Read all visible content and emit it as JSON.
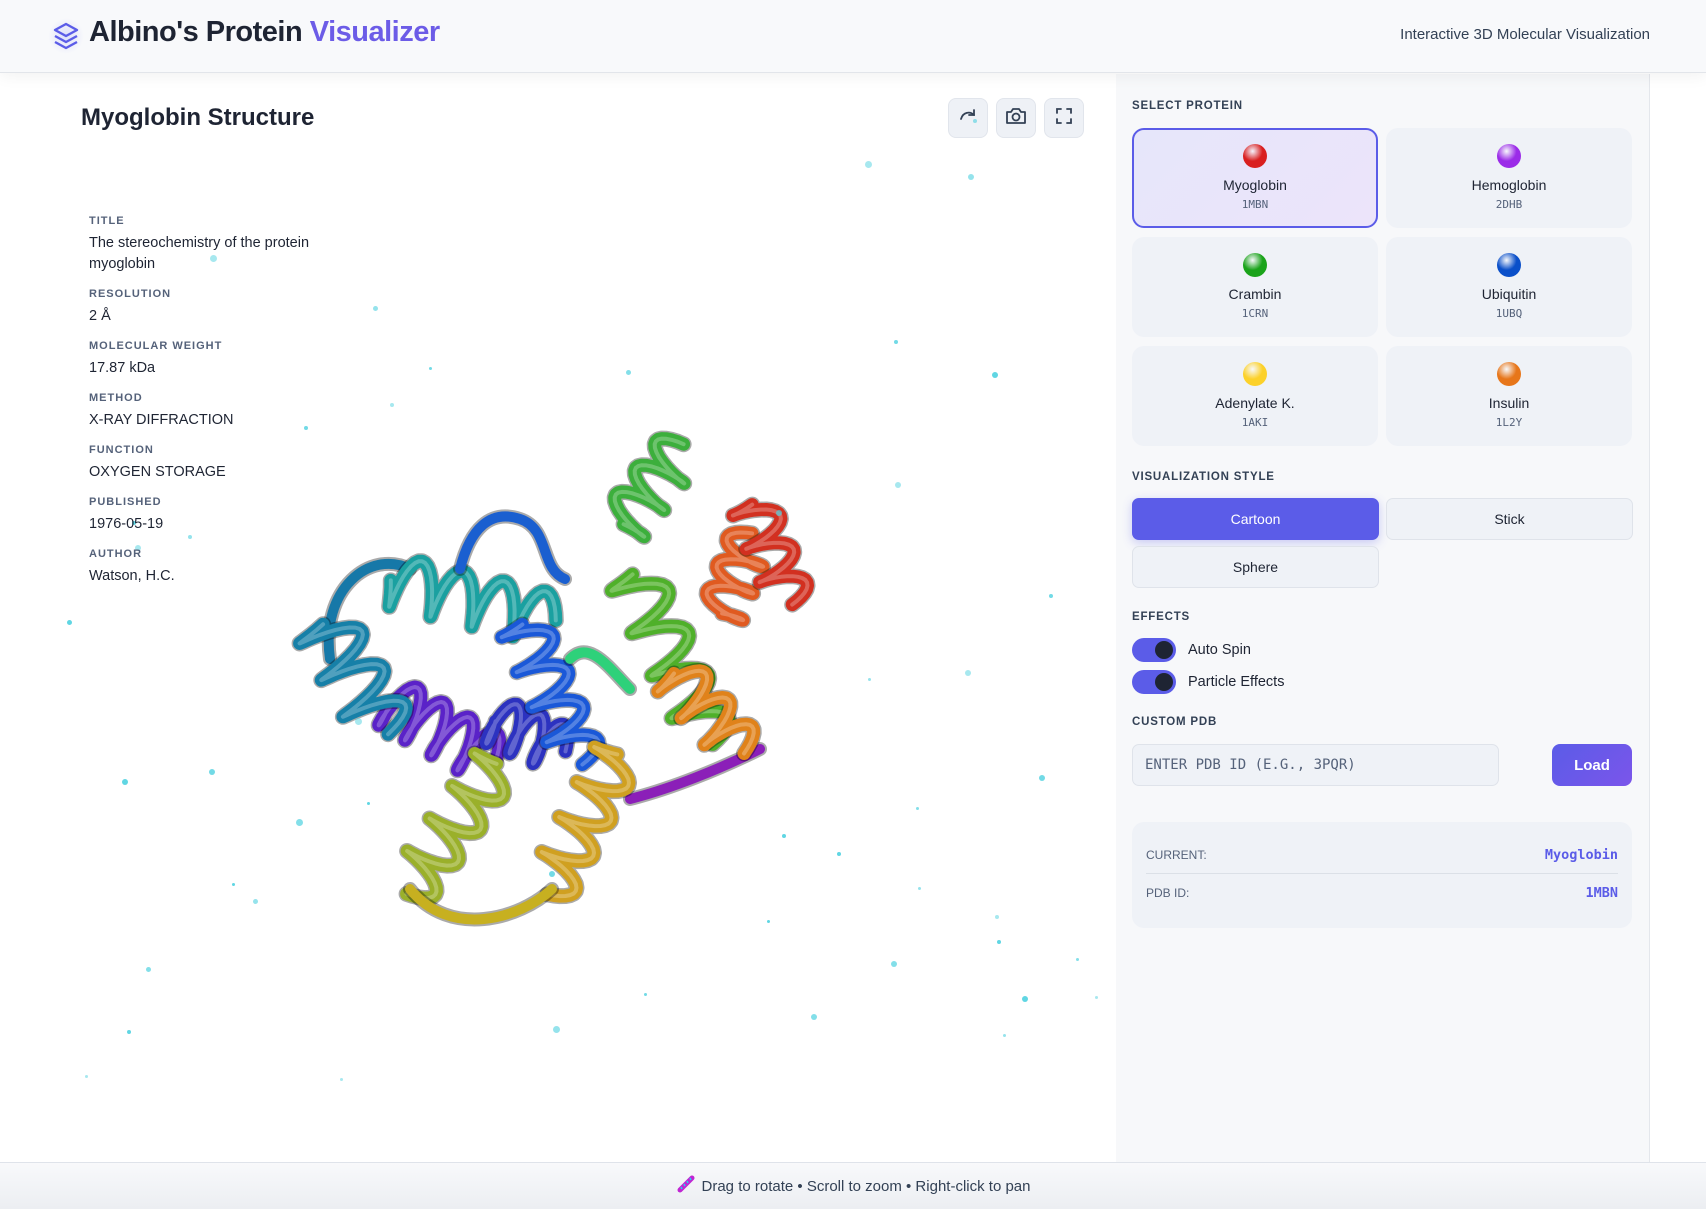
{
  "header": {
    "title_main": "Albino's Protein",
    "title_accent": "Visualizer",
    "subtitle": "Interactive 3D Molecular Visualization"
  },
  "viewer": {
    "title": "Myoglobin Structure",
    "toolbar": {
      "rotate": "rotate-icon",
      "screenshot": "camera-icon",
      "fullscreen": "fullscreen-icon"
    },
    "info": [
      {
        "label": "TITLE",
        "value": "The stereochemistry of the protein myoglobin"
      },
      {
        "label": "RESOLUTION",
        "value": "2 Å"
      },
      {
        "label": "MOLECULAR WEIGHT",
        "value": "17.87 kDa"
      },
      {
        "label": "METHOD",
        "value": "X-RAY DIFFRACTION"
      },
      {
        "label": "FUNCTION",
        "value": "OXYGEN STORAGE"
      },
      {
        "label": "PUBLISHED",
        "value": "1976-05-19"
      },
      {
        "label": "AUTHOR",
        "value": "Watson, H.C."
      }
    ]
  },
  "sidebar": {
    "select_label": "SELECT PROTEIN",
    "proteins": [
      {
        "name": "Myoglobin",
        "id": "1MBN",
        "color": "#d91f1f",
        "selected": true
      },
      {
        "name": "Hemoglobin",
        "id": "2DHB",
        "color": "#9b2be8"
      },
      {
        "name": "Crambin",
        "id": "1CRN",
        "color": "#1aa31a"
      },
      {
        "name": "Ubiquitin",
        "id": "1UBQ",
        "color": "#0a4fc9"
      },
      {
        "name": "Adenylate K.",
        "id": "1AKI",
        "color": "#fcd12a"
      },
      {
        "name": "Insulin",
        "id": "1L2Y",
        "color": "#e7761a"
      }
    ],
    "style_label": "VISUALIZATION STYLE",
    "styles": [
      {
        "label": "Cartoon",
        "active": true
      },
      {
        "label": "Stick"
      },
      {
        "label": "Sphere"
      }
    ],
    "effects_label": "EFFECTS",
    "effects": [
      {
        "label": "Auto Spin",
        "on": true
      },
      {
        "label": "Particle Effects",
        "on": true
      }
    ],
    "custom_label": "CUSTOM PDB",
    "pdb_placeholder": "ENTER PDB ID (E.G., 3PQR)",
    "load_label": "Load",
    "status": {
      "current_label": "CURRENT:",
      "current_value": "Myoglobin",
      "pdb_label": "PDB ID:",
      "pdb_value": "1MBN"
    }
  },
  "footer": {
    "icon": "dna-icon",
    "text": "Drag to rotate • Scroll to zoom • Right-click to pan"
  },
  "colors": {
    "accent": "#5b5ce8",
    "particle": "#4fd1e0"
  }
}
